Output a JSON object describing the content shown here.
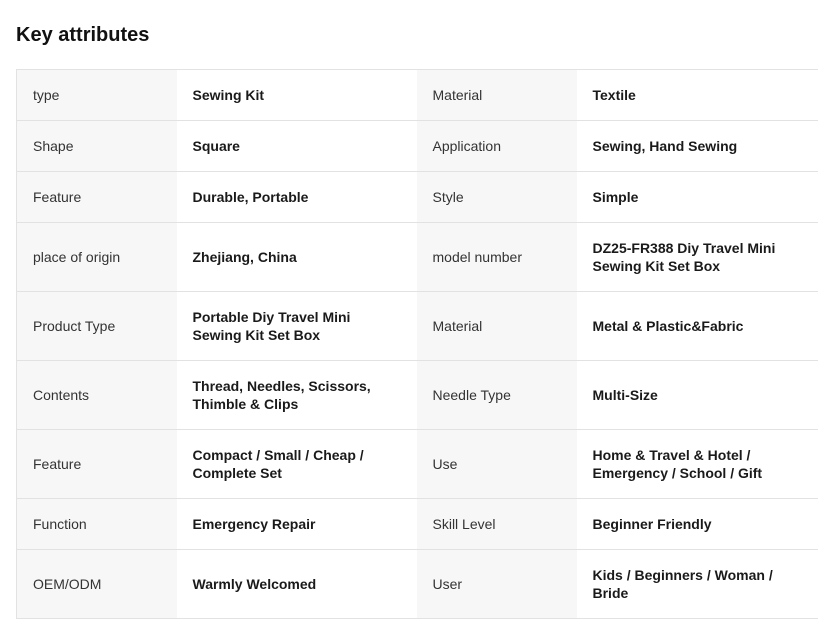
{
  "title": "Key attributes",
  "rows": [
    {
      "k1": "type",
      "v1": "Sewing Kit",
      "k2": "Material",
      "v2": "Textile"
    },
    {
      "k1": "Shape",
      "v1": "Square",
      "k2": "Application",
      "v2": "Sewing, Hand Sewing"
    },
    {
      "k1": "Feature",
      "v1": "Durable, Portable",
      "k2": "Style",
      "v2": "Simple"
    },
    {
      "k1": "place of origin",
      "v1": "Zhejiang, China",
      "k2": "model number",
      "v2": "DZ25-FR388 Diy Travel Mini Sewing Kit Set Box"
    },
    {
      "k1": "Product Type",
      "v1": "Portable Diy Travel Mini Sewing Kit Set Box",
      "k2": "Material",
      "v2": "Metal & Plastic&Fabric"
    },
    {
      "k1": "Contents",
      "v1": "Thread, Needles, Scissors, Thimble & Clips",
      "k2": "Needle Type",
      "v2": "Multi-Size"
    },
    {
      "k1": "Feature",
      "v1": "Compact / Small / Cheap / Complete Set",
      "k2": "Use",
      "v2": "Home & Travel & Hotel / Emergency / School / Gift"
    },
    {
      "k1": "Function",
      "v1": "Emergency Repair",
      "k2": "Skill Level",
      "v2": "Beginner Friendly"
    },
    {
      "k1": "OEM/ODM",
      "v1": "Warmly Welcomed",
      "k2": "User",
      "v2": "Kids / Beginners / Woman / Bride"
    }
  ]
}
